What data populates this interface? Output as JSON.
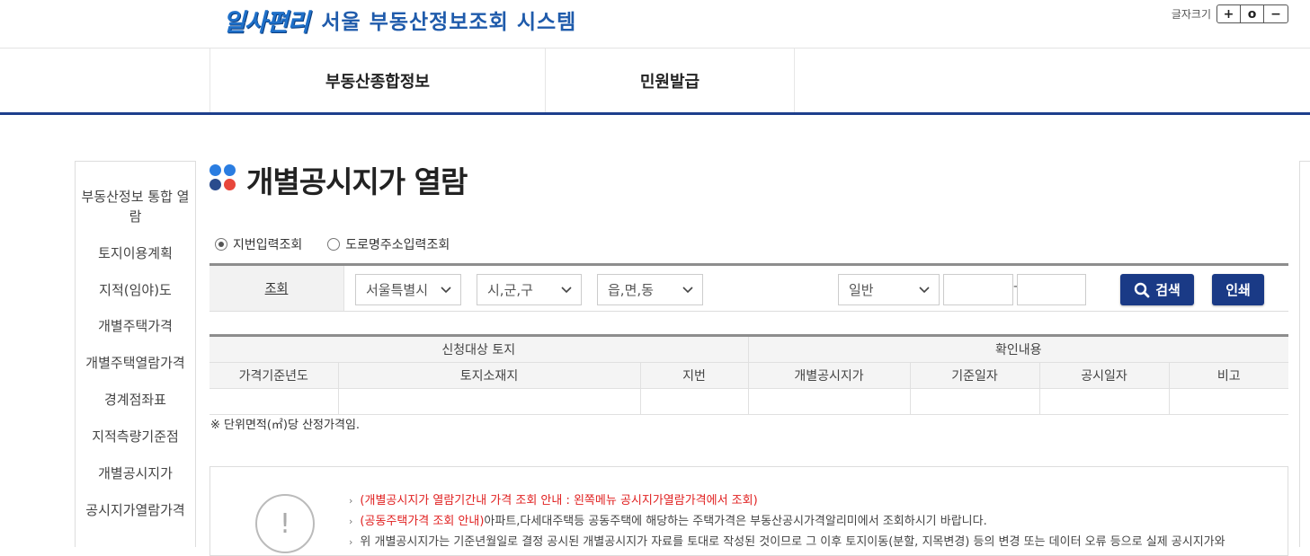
{
  "header": {
    "logo_mark": "일사편리",
    "logo_text": "서울 부동산정보조회 시스템",
    "font_size_label": "글자크기",
    "font_buttons": [
      "+",
      "o",
      "−"
    ]
  },
  "gnb": {
    "items": [
      "부동산종합정보",
      "민원발급"
    ]
  },
  "sidebar": {
    "items": [
      "부동산정보 통합 열람",
      "토지이용계획",
      "지적(임야)도",
      "개별주택가격",
      "개별주택열람가격",
      "경계점좌표",
      "지적측량기준점",
      "개별공시지가",
      "공시지가열람가격"
    ]
  },
  "page": {
    "title": "개별공시지가 열람",
    "dot_colors": [
      "#2a7de1",
      "#2a7de1",
      "#2a4b8d",
      "#e8473c"
    ]
  },
  "radios": [
    {
      "label": "지번입력조회",
      "checked": true
    },
    {
      "label": "도로명주소입력조회",
      "checked": false
    }
  ],
  "search": {
    "label": "조회",
    "city": "서울특별시",
    "district": "시,군,구",
    "town": "읍,면,동",
    "land_type": "일반",
    "main_no": "",
    "sub_no": "",
    "dash": "-",
    "search_button": "검색",
    "print_button": "인쇄"
  },
  "table": {
    "group_headers": [
      "신청대상 토지",
      "확인내용"
    ],
    "headers": [
      "가격기준년도",
      "토지소재지",
      "지번",
      "개별공시지가",
      "기준일자",
      "공시일자",
      "비고"
    ]
  },
  "note": "※ 단위면적(㎡)당 산정가격임.",
  "info": {
    "icon": "!",
    "line1": "(개별공시지가 열람기간내 가격 조회 안내 : 왼쪽메뉴 공시지가열람가격에서 조회)",
    "line2_red": "(공동주택가격 조회 안내)",
    "line2_rest": "아파트,다세대주택등 공동주택에 해당하는 주택가격은 부동산공시가격알리미에서 조회하시기 바랍니다.",
    "line3": "위 개별공시지가는 기준년월일로 결정 공시된 개별공시지가 자료를 토대로 작성된 것이므로 그 이후 토지이동(분할, 지목변경) 등의 변경 또는 데이터 오류 등으로 실제 공시지가와"
  },
  "colors": {
    "navy": "#1a3a86",
    "gnb_border": "#1d3f8c",
    "alert_red": "#e02020"
  }
}
